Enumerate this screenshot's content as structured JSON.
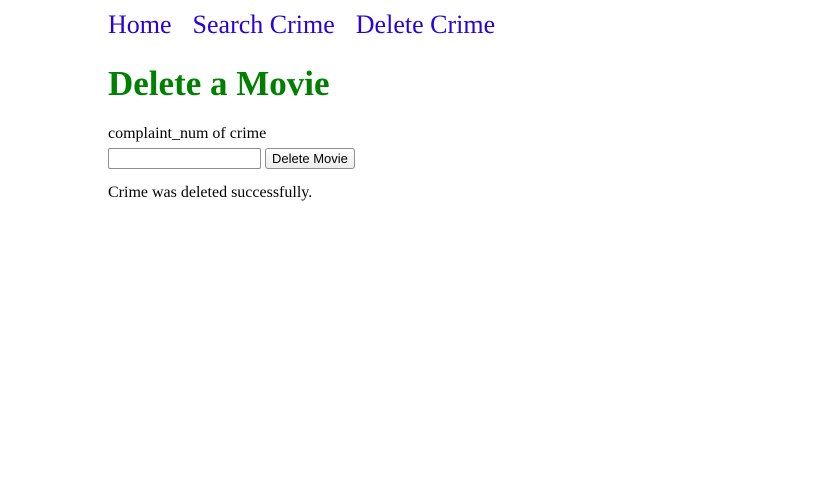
{
  "nav": {
    "items": [
      {
        "label": "Home"
      },
      {
        "label": "Search Crime"
      },
      {
        "label": "Delete Crime"
      }
    ],
    "link_color": "#2a00dd"
  },
  "page": {
    "title": "Delete a Movie",
    "title_color": "#008000"
  },
  "form": {
    "field_label": "complaint_num of crime",
    "input_value": "",
    "input_placeholder": "",
    "submit_label": "Delete Movie"
  },
  "status": {
    "message": "Crime was deleted successfully."
  }
}
